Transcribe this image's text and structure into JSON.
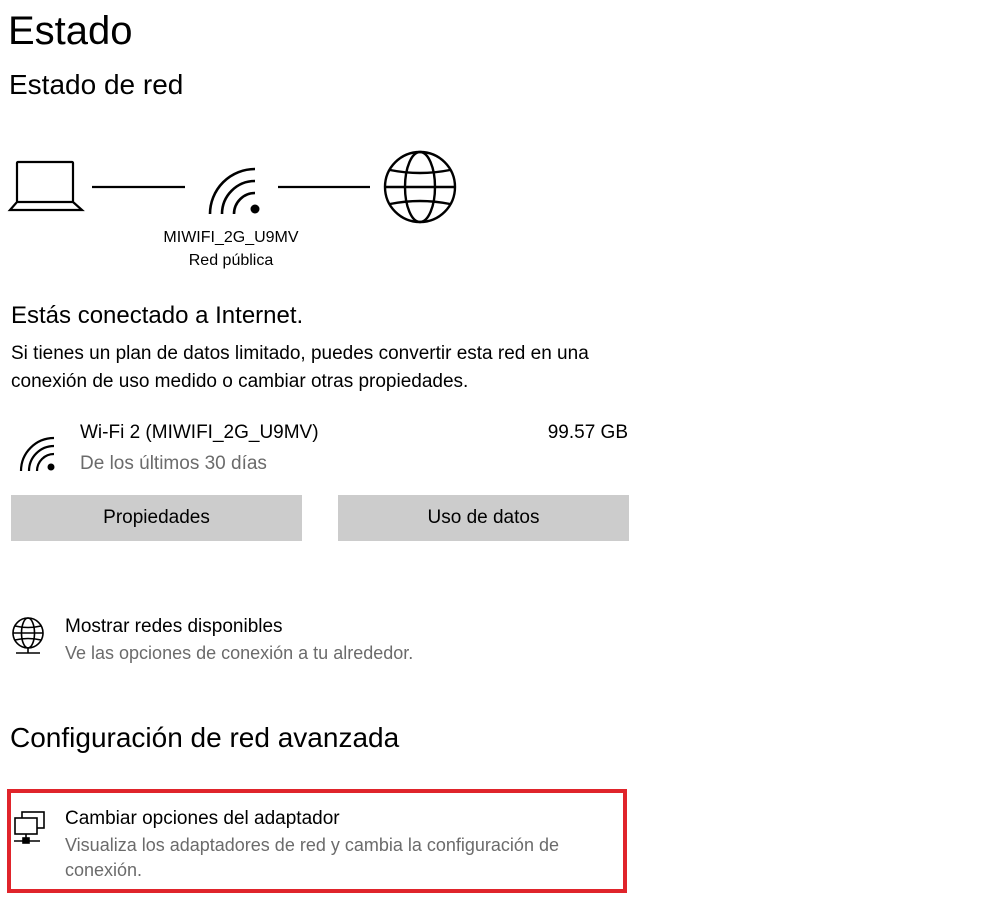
{
  "header": {
    "title": "Estado",
    "section_title": "Estado de red"
  },
  "network_diagram": {
    "network_name": "MIWIFI_2G_U9MV",
    "network_type": "Red pública",
    "icons": [
      "laptop-icon",
      "wifi-icon",
      "globe-icon"
    ]
  },
  "connection": {
    "status": "Estás conectado a Internet.",
    "description": "Si tienes un plan de datos limitado, puedes convertir esta red en una conexión de uso medido o cambiar otras propiedades."
  },
  "adapter": {
    "name": "Wi-Fi 2 (MIWIFI_2G_U9MV)",
    "usage": "99.57 GB",
    "period": "De los últimos 30 días"
  },
  "buttons": {
    "properties": "Propiedades",
    "data_usage": "Uso de datos"
  },
  "show_networks": {
    "title": "Mostrar redes disponibles",
    "description": "Ve las opciones de conexión a tu alrededor."
  },
  "advanced": {
    "title": "Configuración de red avanzada"
  },
  "change_adapter": {
    "title": "Cambiar opciones del adaptador",
    "description": "Visualiza los adaptadores de red y cambia la configuración de conexión."
  },
  "colors": {
    "highlight": "#e0242b",
    "button_bg": "#cccccc",
    "secondary_text": "#6b6b6b"
  }
}
